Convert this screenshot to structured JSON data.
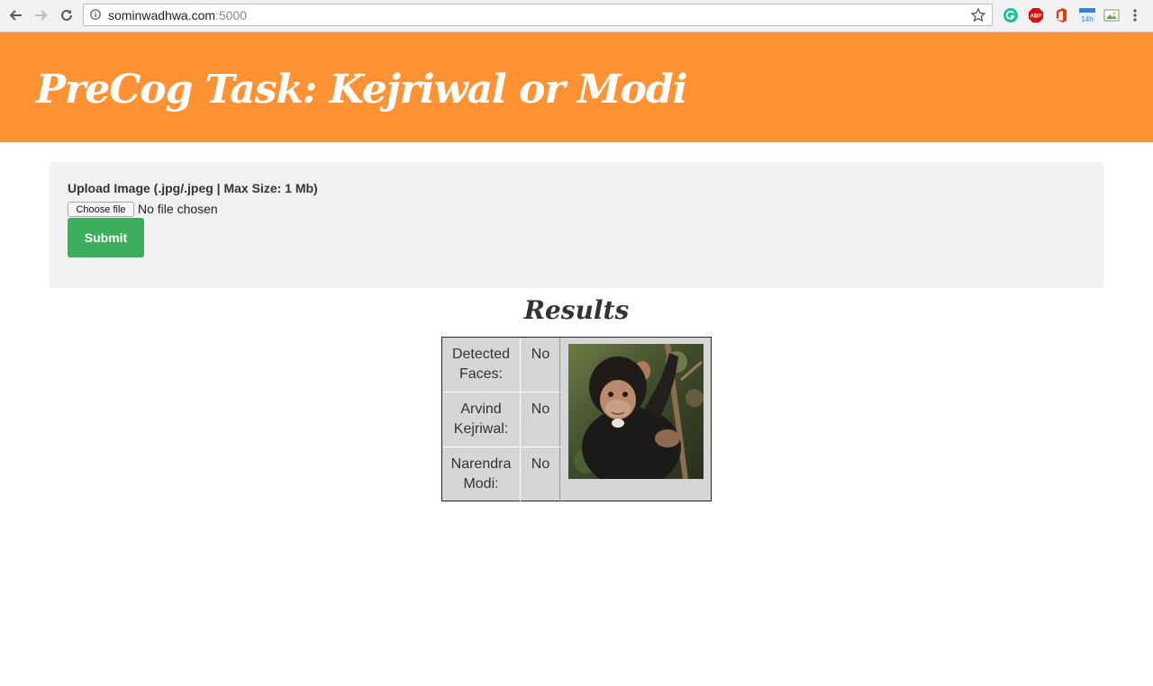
{
  "browser": {
    "url_host": "sominwadhwa.com",
    "url_port": ":5000"
  },
  "header": {
    "title": "PreCog Task: Kejriwal or Modi"
  },
  "upload": {
    "label": "Upload Image (.jpg/.jpeg | Max Size: 1 Mb)",
    "choose_file_label": "Choose file",
    "file_status": "No file chosen",
    "submit_label": "Submit"
  },
  "results": {
    "title": "Results",
    "rows": [
      {
        "label_line1": "Detected",
        "label_line2": "Faces:",
        "value": "No"
      },
      {
        "label_line1": "Arvind",
        "label_line2": "Kejriwal:",
        "value": "No"
      },
      {
        "label_line1": "Narendra",
        "label_line2": "Modi:",
        "value": "No"
      }
    ],
    "image_subject": "chimpanzee"
  },
  "colors": {
    "banner": "#ff9234",
    "submit": "#3cae5c",
    "panel": "#f1f1f1",
    "table_bg": "#d6d6d6"
  }
}
